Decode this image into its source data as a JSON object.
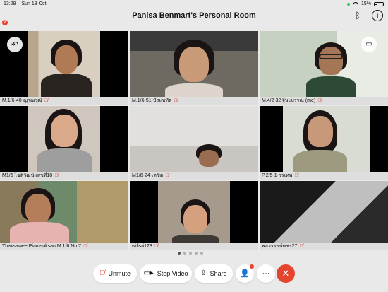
{
  "status": {
    "time": "13:29",
    "date": "Sun 18 Oct",
    "battery": "15%"
  },
  "header": {
    "title": "Panisa Benmart's Personal Room",
    "notification_count": "2"
  },
  "participants": [
    {
      "name": "M.1/6-40-ญาณวุฒิ"
    },
    {
      "name": "M.1/6-51-ปัณณทัต"
    },
    {
      "name": "M.4/2 32 ฐิษะบรรณ (me)"
    },
    {
      "name": "M1/6 ไชติวัฒน์ เลขที่18"
    },
    {
      "name": "M1/6-24-เตชิต"
    },
    {
      "name": "P.2/5-1-วรเทพ"
    },
    {
      "name": "Thaksawee Piamsuksan M.1/6 No.7"
    },
    {
      "name": "wilisri123"
    },
    {
      "name": "พลวรรธน์พชร27"
    }
  ],
  "pager": {
    "pages": 5,
    "current": 1
  },
  "controls": {
    "unmute_label": "Unmute",
    "stop_video_label": "Stop Video",
    "share_label": "Share",
    "more_label": "···"
  },
  "colors": {
    "end": "#e5452f",
    "muted": "#e03b2e"
  }
}
